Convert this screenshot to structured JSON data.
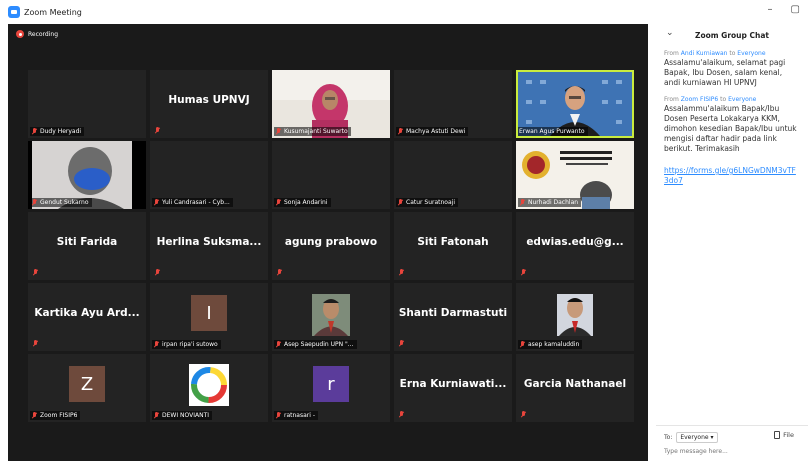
{
  "window": {
    "title": "Zoom Meeting",
    "minimize": "–",
    "restore": "▢"
  },
  "meeting": {
    "recording_label": "Recording"
  },
  "tiles": [
    {
      "id": "dudy",
      "name": "Dudy Heryadi",
      "kind": "blank"
    },
    {
      "id": "humas",
      "big": "Humas UPNVJ",
      "kind": "namecard"
    },
    {
      "id": "kusumajanti",
      "name": "Kusumajanti Suwarto",
      "kind": "video"
    },
    {
      "id": "machya",
      "name": "Machya Astuti Dewi",
      "kind": "blank"
    },
    {
      "id": "erwan",
      "name": "Erwan Agus Purwanto",
      "kind": "video",
      "active": true
    },
    {
      "id": "gendut",
      "name": "Gendut Sukarno",
      "kind": "video"
    },
    {
      "id": "yuli",
      "name": "Yuli Candrasari - Cyb...",
      "kind": "blank"
    },
    {
      "id": "sonja",
      "name": "Sonja Andarini",
      "kind": "blank"
    },
    {
      "id": "catur",
      "name": "Catur Suratnoaji",
      "kind": "blank"
    },
    {
      "id": "nurhadi",
      "name": "Nurhadi Dachlan",
      "kind": "video"
    },
    {
      "id": "siti-farida",
      "big": "Siti Farida",
      "kind": "namecard"
    },
    {
      "id": "herlina",
      "big": "Herlina  Suksma...",
      "kind": "namecard"
    },
    {
      "id": "agung",
      "big": "agung prabowo",
      "kind": "namecard"
    },
    {
      "id": "siti-fatonah",
      "big": "Siti Fatonah",
      "kind": "namecard"
    },
    {
      "id": "edwias",
      "big": "edwias.edu@g...",
      "kind": "namecard"
    },
    {
      "id": "kartika",
      "big": "Kartika Ayu Ard...",
      "kind": "namecard"
    },
    {
      "id": "irpan",
      "name": "irpan ripa'i sutowo",
      "kind": "avatar",
      "letter": "I",
      "color": "#6e4a3c"
    },
    {
      "id": "asep-s",
      "name": "Asep Saepudin UPN \"...",
      "kind": "photo"
    },
    {
      "id": "shanti",
      "big": "Shanti Darmastuti",
      "kind": "namecard"
    },
    {
      "id": "asep-k",
      "name": "asep kamaluddin",
      "kind": "photo"
    },
    {
      "id": "zoom-fisip6",
      "name": "Zoom FISIP6",
      "kind": "avatar",
      "letter": "Z",
      "color": "#6e4a3c"
    },
    {
      "id": "dewi",
      "name": "DEWI NOVIANTI",
      "kind": "logo"
    },
    {
      "id": "ratnasari",
      "name": "ratnasari -",
      "kind": "avatar",
      "letter": "r",
      "color": "#5b3c9b"
    },
    {
      "id": "erna",
      "big": "Erna  Kurniawati...",
      "kind": "namecard"
    },
    {
      "id": "garcia",
      "big": "Garcia Nathanael",
      "kind": "namecard"
    }
  ],
  "chat": {
    "title": "Zoom Group Chat",
    "messages": [
      {
        "from": "Andi Kurniawan",
        "to": "Everyone",
        "text": "Assalamu'alaikum, selamat pagi Bapak, Ibu Dosen, salam kenal, andi kurniawan HI UPNVJ"
      },
      {
        "from": "Zoom FISIP6",
        "to": "Everyone",
        "text": "Assalammu'alaikum Bapak/Ibu Dosen Peserta Lokakarya KKM, dimohon kesedian Bapak/Ibu untuk mengisi daftar hadir pada link berikut. Terimakasih",
        "link": "https://forms.gle/g6LNGwDNM3vTF3do7"
      }
    ],
    "from_word": "From",
    "to_word": "to",
    "to_label": "To:",
    "recipient": "Everyone",
    "file_label": "File",
    "input_placeholder": "Type message here..."
  }
}
